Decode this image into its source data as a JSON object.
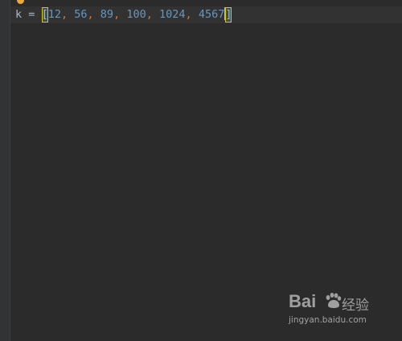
{
  "editor": {
    "code_line": {
      "variable": "k",
      "operator": "=",
      "open_bracket": "[",
      "close_bracket": "]",
      "numbers": [
        "12",
        "56",
        "89",
        "100",
        "1024",
        "4567"
      ],
      "separator": ","
    }
  },
  "watermark": {
    "logo_text": "Bai",
    "cn_text": "经验",
    "url": "jingyan.baidu.com"
  },
  "colors": {
    "background": "#2b2b2b",
    "gutter": "#313335",
    "number": "#6897bb",
    "comma": "#cc7832",
    "text": "#a9b7c6",
    "bracket_highlight": "#3b514d",
    "bracket_outline": "#d4c61a",
    "bulb": "#f0a732"
  },
  "icons": {
    "bulb": "intention-bulb-icon",
    "paw": "baidu-paw-icon"
  }
}
